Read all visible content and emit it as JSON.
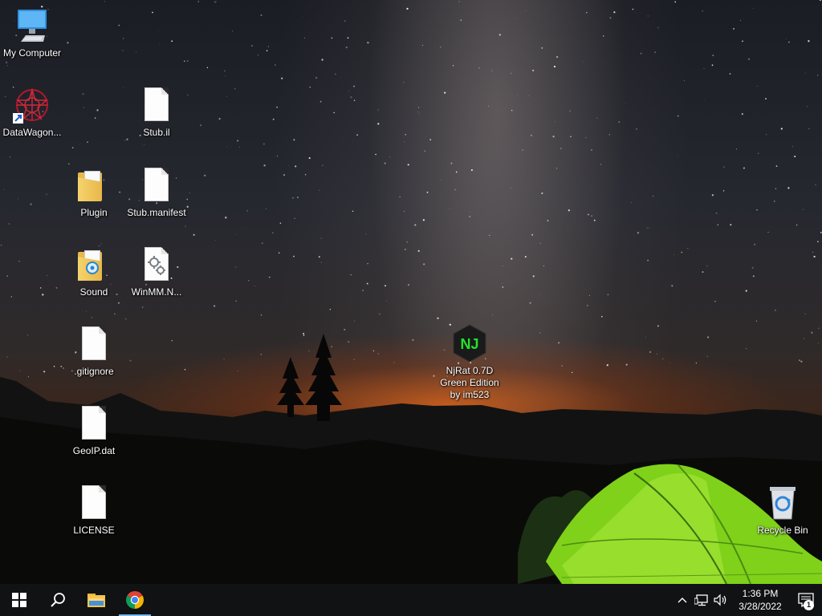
{
  "desktop": {
    "icons": {
      "my_computer": "My Computer",
      "datawagon": "DataWagon...",
      "plugin": "Plugin",
      "sound": "Sound",
      "gitignore": ".gitignore",
      "geoip": "GeoIP.dat",
      "license": "LICENSE",
      "stub_il": "Stub.il",
      "stub_manifest": "Stub.manifest",
      "winmm": "WinMM.N...",
      "njrat": "NjRat 0.7D\nGreen Edition\nby im523",
      "recycle_bin": "Recycle Bin"
    },
    "njrat_logo_text": "NJ"
  },
  "taskbar": {
    "start_icon": "windows-logo",
    "search_icon": "magnifier",
    "pinned": [
      "file-explorer",
      "chrome"
    ],
    "tray": {
      "time": "1:36 PM",
      "date": "3/28/2022",
      "notification_count": "1"
    }
  }
}
